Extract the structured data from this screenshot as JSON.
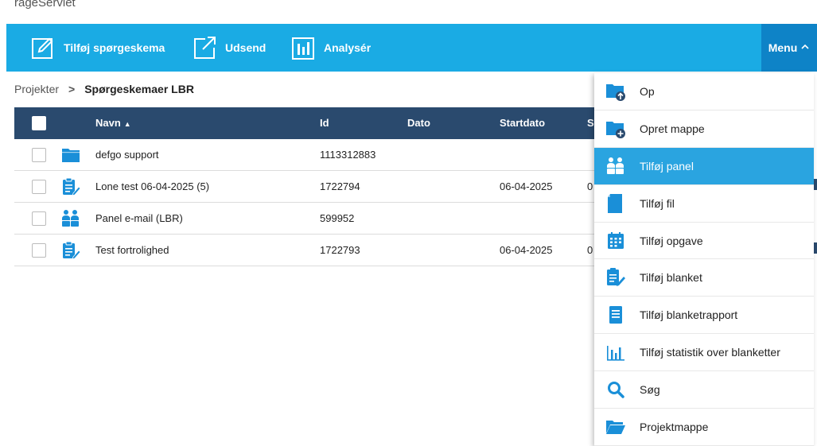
{
  "app": {
    "title": "rageServlet"
  },
  "toolbar": {
    "add_label": "Tilføj spørgeskema",
    "send_label": "Udsend",
    "analyze_label": "Analysér",
    "menu_label": "Menu",
    "background": "#1aabe4",
    "menu_background": "#0e83c7"
  },
  "breadcrumb": {
    "root": "Projekter",
    "separator": ">",
    "current": "Spørgeskemaer LBR"
  },
  "table": {
    "columns": {
      "name": "Navn",
      "id": "Id",
      "dato": "Dato",
      "startdato": "Startdato",
      "extra": "S"
    },
    "header_background": "#2a4a6e",
    "rows": [
      {
        "icon": "folder-icon",
        "name": "defgo support",
        "id": "1113312883",
        "dato": "",
        "startdato": "",
        "extra": ""
      },
      {
        "icon": "survey-icon",
        "name": "Lone test 06-04-2025 (5)",
        "id": "1722794",
        "dato": "",
        "startdato": "06-04-2025",
        "extra": "0"
      },
      {
        "icon": "panel-icon",
        "name": "Panel e-mail (LBR)",
        "id": "599952",
        "dato": "",
        "startdato": "",
        "extra": ""
      },
      {
        "icon": "survey-icon",
        "name": "Test fortrolighed",
        "id": "1722793",
        "dato": "",
        "startdato": "06-04-2025",
        "extra": "0"
      }
    ]
  },
  "menu": {
    "items": [
      {
        "label": "Op",
        "icon": "folder-up-icon"
      },
      {
        "label": "Opret mappe",
        "icon": "folder-add-icon"
      },
      {
        "label": "Tilføj panel",
        "icon": "panel-icon",
        "active": true
      },
      {
        "label": "Tilføj fil",
        "icon": "file-icon"
      },
      {
        "label": "Tilføj opgave",
        "icon": "calendar-icon"
      },
      {
        "label": "Tilføj blanket",
        "icon": "form-edit-icon"
      },
      {
        "label": "Tilføj blanketrapport",
        "icon": "report-icon"
      },
      {
        "label": "Tilføj statistik over blanketter",
        "icon": "bar-chart-icon"
      },
      {
        "label": "Søg",
        "icon": "search-icon"
      },
      {
        "label": "Projektmappe",
        "icon": "folder-open-icon"
      }
    ],
    "active_color": "#2aa4e0",
    "icon_color": "#1a8fd8"
  }
}
